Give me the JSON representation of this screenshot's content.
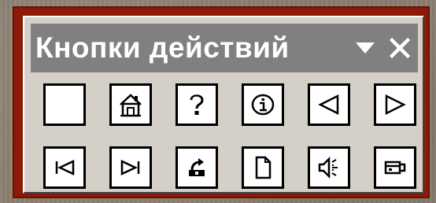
{
  "toolbar": {
    "title": "Кнопки действий",
    "controls": [
      {
        "name": "dropdown-arrow-icon",
        "glyph": "▼"
      },
      {
        "name": "close-icon",
        "glyph": "✕"
      }
    ]
  },
  "buttons": [
    {
      "name": "custom-action-button",
      "icon": "blank"
    },
    {
      "name": "home-action-button",
      "icon": "home"
    },
    {
      "name": "help-action-button",
      "icon": "help"
    },
    {
      "name": "information-action-button",
      "icon": "information"
    },
    {
      "name": "back-previous-action-button",
      "icon": "back"
    },
    {
      "name": "forward-next-action-button",
      "icon": "forward"
    },
    {
      "name": "beginning-action-button",
      "icon": "beginning"
    },
    {
      "name": "end-action-button",
      "icon": "end"
    },
    {
      "name": "return-action-button",
      "icon": "return"
    },
    {
      "name": "document-action-button",
      "icon": "document"
    },
    {
      "name": "sound-action-button",
      "icon": "sound"
    },
    {
      "name": "movie-action-button",
      "icon": "movie"
    }
  ]
}
